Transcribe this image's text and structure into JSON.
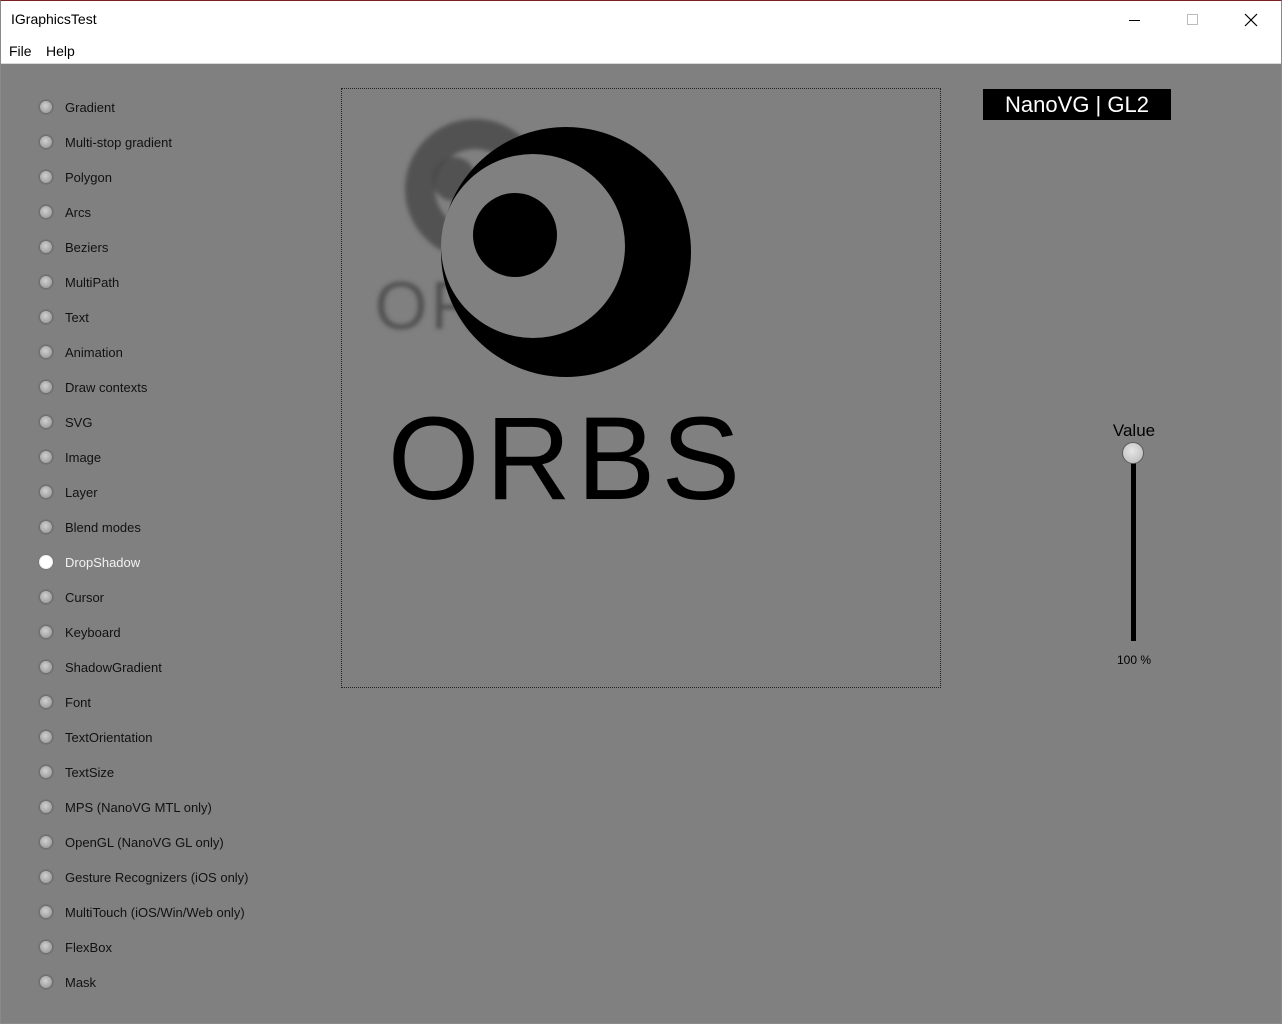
{
  "window": {
    "title": "IGraphicsTest"
  },
  "menubar": {
    "items": [
      "File",
      "Help"
    ]
  },
  "tests": {
    "selected": "DropShadow",
    "items": [
      "Gradient",
      "Multi-stop gradient",
      "Polygon",
      "Arcs",
      "Beziers",
      "MultiPath",
      "Text",
      "Animation",
      "Draw contexts",
      "SVG",
      "Image",
      "Layer",
      "Blend modes",
      "DropShadow",
      "Cursor",
      "Keyboard",
      "ShadowGradient",
      "Font",
      "TextOrientation",
      "TextSize",
      "MPS (NanoVG MTL only)",
      "OpenGL (NanoVG GL only)",
      "Gesture Recognizers (iOS only)",
      "MultiTouch (iOS/Win/Web only)",
      "FlexBox",
      "Mask"
    ]
  },
  "canvas": {
    "logo_text": "ORBS",
    "shadow_color": "#4a4a4a",
    "logo_color": "#000000"
  },
  "backend": {
    "label": "NanoVG | GL2"
  },
  "slider": {
    "title": "Value",
    "value_text": "100 %",
    "value": 1.0
  },
  "colors": {
    "background": "#808080",
    "chrome": "#ffffff",
    "selected_label": "#f2f2f2"
  }
}
